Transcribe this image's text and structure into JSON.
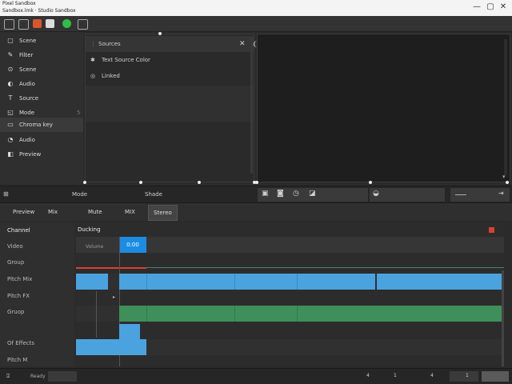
{
  "window": {
    "title_line1": "Pixel Sandbox",
    "title_line2": "Sandbox.lmk · Studio Sandbox",
    "controls": [
      "—",
      "▢",
      "✕"
    ]
  },
  "toolbar": {
    "icons": [
      "folder-icon",
      "save-icon",
      "record-icon",
      "green-blob-icon",
      "share-icon"
    ]
  },
  "sidebar": {
    "items": [
      {
        "icon": "▢",
        "label": "Scene",
        "selected": false
      },
      {
        "icon": "✎",
        "label": "Filter",
        "selected": false
      },
      {
        "icon": "⊙",
        "label": "Scene",
        "selected": false
      },
      {
        "icon": "◐",
        "label": "Audio",
        "selected": false
      },
      {
        "icon": "T",
        "label": "Source",
        "selected": false
      },
      {
        "icon": "◱",
        "label": "Mode",
        "selected": false
      },
      {
        "icon": "▭",
        "label": "Chroma key",
        "selected": true
      },
      {
        "icon": "◔",
        "label": "Audio",
        "selected": false
      },
      {
        "icon": "◧",
        "label": "Preview",
        "selected": false
      }
    ]
  },
  "midpanel": {
    "header": "Sources",
    "rows": [
      {
        "icon": "✱",
        "label": "Text Source Color"
      },
      {
        "icon": "◎",
        "label": "Linked"
      }
    ]
  },
  "midbar": {
    "left_label": "Mode",
    "center_label": "Shade",
    "icons": [
      "image-icon",
      "record-icon",
      "speed-icon",
      "export-icon",
      "eye-icon"
    ]
  },
  "tabs": [
    {
      "label": "Preview",
      "active": false
    },
    {
      "label": "Mix",
      "active": false
    },
    {
      "label": "Mute",
      "active": false
    },
    {
      "label": "MIX",
      "active": false
    },
    {
      "label": "Stereo",
      "active": true
    }
  ],
  "timeline": {
    "header_label": "Ducking",
    "ruler_label": "Volume",
    "playhead_label": "0:00",
    "track_labels": [
      "Channel",
      "Video",
      "Group",
      "Pitch Mix",
      "Pitch FX",
      "Gruop",
      "Of Effects",
      "Pitch M"
    ],
    "colors": {
      "blue": "#4aa3df",
      "green": "#3f8f5a",
      "playhead": "#1c8ce3",
      "marker": "#d9412e"
    }
  },
  "statusbar": {
    "left_label": "Ready",
    "markers": [
      "4",
      "1",
      "4",
      "1"
    ]
  }
}
